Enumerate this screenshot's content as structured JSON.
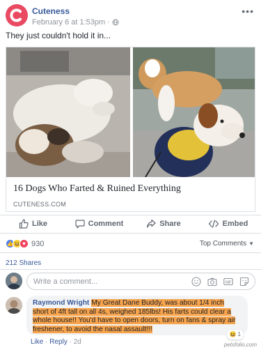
{
  "post": {
    "page_name": "Cuteness",
    "date": "February 6 at 1:53pm",
    "separator": "·",
    "text": "They just couldn't hold it in..."
  },
  "link": {
    "title": "16 Dogs Who Farted & Ruined Everything",
    "domain": "CUTENESS.COM"
  },
  "actions": {
    "like": "Like",
    "comment": "Comment",
    "share": "Share",
    "embed": "Embed"
  },
  "reactions": {
    "count": "930",
    "top_comments": "Top Comments"
  },
  "shares": "212 Shares",
  "comment_input": {
    "placeholder": "Write a comment..."
  },
  "comment": {
    "author": "Raymond Wright",
    "text": "My Great Dane Buddy, was about 1/4 inch short of 4ft tall on all 4s, weighed 185lbs! His farts could clear a whole house!! You'd have to open doors, turn on fans & spray air freshener, to avoid the nasal assault!!!",
    "reaction_count": "1",
    "like": "Like",
    "reply": "Reply",
    "dot": "·",
    "age": "2d"
  },
  "watermark": "petsfolio.com",
  "colors": {
    "brand": "#e94a62",
    "link": "#365899",
    "highlight": "#f7a44c"
  }
}
